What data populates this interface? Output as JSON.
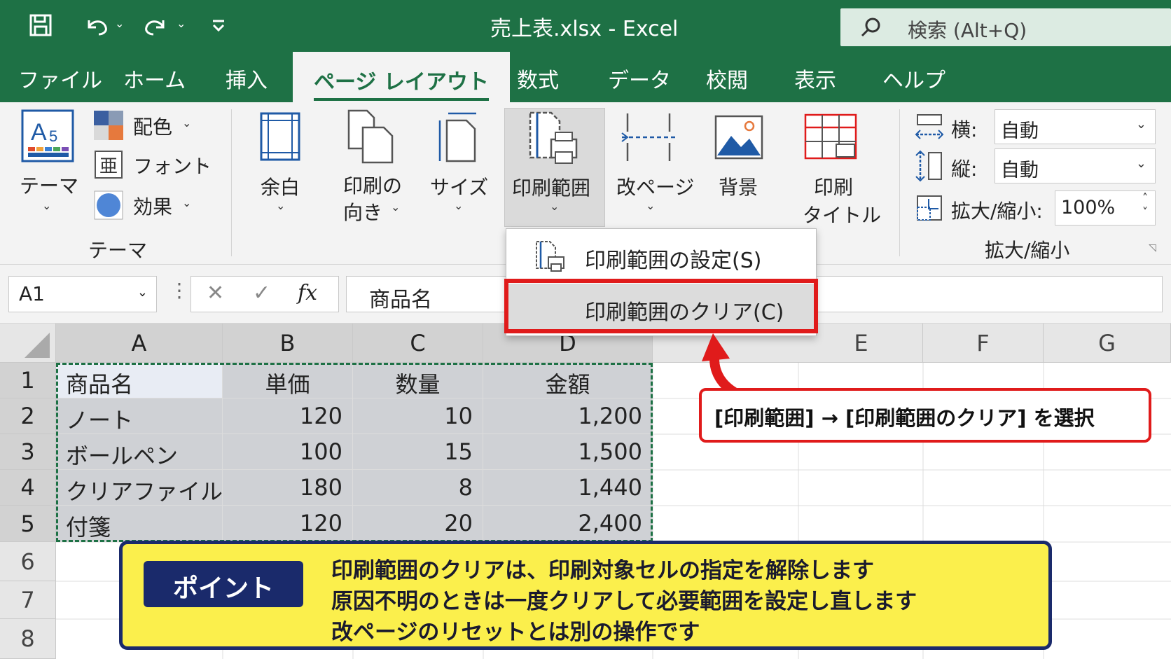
{
  "window": {
    "title": "売上表.xlsx  -  Excel",
    "search_placeholder": "検索 (Alt+Q)"
  },
  "tabs": [
    {
      "label": "ファイル"
    },
    {
      "label": "ホーム"
    },
    {
      "label": "挿入"
    },
    {
      "label": "ページ レイアウト",
      "active": true
    },
    {
      "label": "数式"
    },
    {
      "label": "データ"
    },
    {
      "label": "校閲"
    },
    {
      "label": "表示"
    },
    {
      "label": "ヘルプ"
    }
  ],
  "ribbon": {
    "themes": {
      "theme_label": "テーマ",
      "colors_label": "配色",
      "fonts_label": "フォント",
      "effects_label": "効果",
      "group_label": "テーマ"
    },
    "page_setup": {
      "margins_label": "余白",
      "orientation_label_1": "印刷の",
      "orientation_label_2": "向き",
      "size_label": "サイズ",
      "print_area_label": "印刷範囲",
      "breaks_label": "改ページ",
      "background_label": "背景",
      "print_titles_label_1": "印刷",
      "print_titles_label_2": "タイトル"
    },
    "scale": {
      "width_label": "横:",
      "width_value": "自動",
      "height_label": "縦:",
      "height_value": "自動",
      "scale_label": "拡大/縮小:",
      "scale_value": "100%",
      "group_label": "拡大/縮小"
    }
  },
  "formula_bar": {
    "name_box": "A1",
    "cancel_symbol": "✕",
    "enter_symbol": "✓",
    "fx_symbol": "fx",
    "formula": "商品名"
  },
  "dropdown": {
    "items": [
      {
        "label": "印刷範囲の設定(S)"
      },
      {
        "label": "印刷範囲のクリア(C)",
        "highlighted": true
      }
    ]
  },
  "sheet": {
    "columns": [
      "A",
      "B",
      "C",
      "D",
      "E",
      "F",
      "G"
    ],
    "rows": [
      "1",
      "2",
      "3",
      "4",
      "5",
      "6",
      "7",
      "8"
    ],
    "header": [
      "商品名",
      "単価",
      "数量",
      "金額"
    ],
    "data": [
      [
        "ノート",
        "120",
        "10",
        "1,200"
      ],
      [
        "ボールペン",
        "100",
        "15",
        "1,500"
      ],
      [
        "クリアファイル",
        "180",
        "8",
        "1,440"
      ],
      [
        "付箋",
        "120",
        "20",
        "2,400"
      ]
    ]
  },
  "annotations": {
    "instruction": "[印刷範囲] → [印刷範囲のクリア] を選択",
    "point_badge": "ポイント",
    "point_lines": [
      "印刷範囲のクリアは、印刷対象セルの指定を解除します",
      "原因不明のときは一度クリアして必要範囲を設定し直します",
      "改ページのリセットとは別の操作です"
    ]
  },
  "colors": {
    "excel_green": "#1e7145",
    "highlight_red": "#e01b1b",
    "point_yellow": "#fbef4c",
    "point_navy": "#1a2a6b"
  }
}
